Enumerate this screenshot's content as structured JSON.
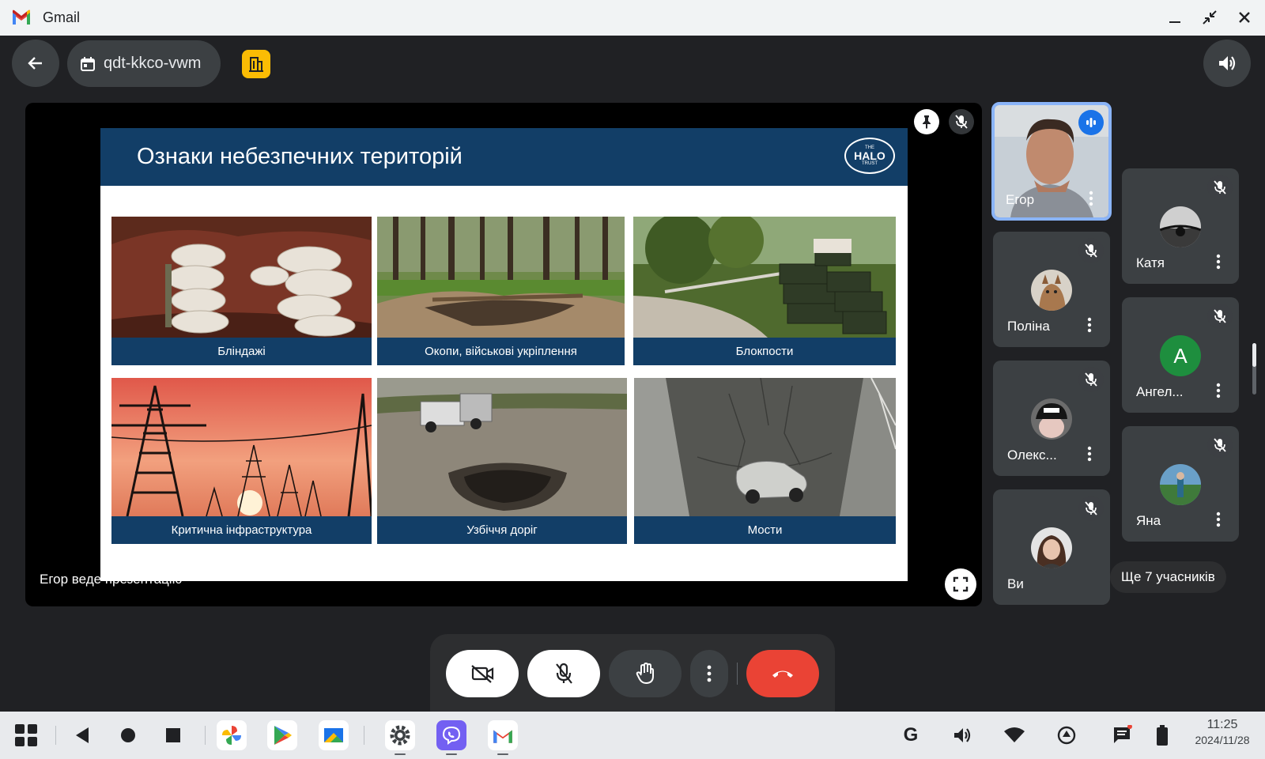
{
  "window": {
    "app_title": "Gmail"
  },
  "meeting": {
    "code": "qdt-kkco-vwm",
    "presenter_note": "Егор веде презентацію",
    "more_participants": "Ще 7 учасників"
  },
  "slide": {
    "title": "Ознаки небезпечних територій",
    "logo": {
      "line1": "THE",
      "line2": "HALO",
      "line3": "TRUST"
    },
    "items": [
      {
        "caption": "Бліндажі"
      },
      {
        "caption": "Окопи, військові укріплення"
      },
      {
        "caption": "Блокпости"
      },
      {
        "caption": "Критична інфраструктура"
      },
      {
        "caption": "Узбіччя доріг"
      },
      {
        "caption": "Мости"
      }
    ]
  },
  "participants": [
    {
      "name": "Егор",
      "speaking": true
    },
    {
      "name": "Поліна",
      "muted": true
    },
    {
      "name": "Олекс...",
      "muted": true
    },
    {
      "name": "Ви",
      "muted": true
    },
    {
      "name": "Катя",
      "muted": true
    },
    {
      "name": "Ангел...",
      "muted": true,
      "initial": "A"
    },
    {
      "name": "Яна",
      "muted": true
    }
  ],
  "controls": {
    "camera": "camera-off",
    "mic": "mic-off",
    "hand": "raise-hand",
    "more": "more-options",
    "end": "end-call"
  },
  "taskbar": {
    "time": "11:25",
    "date": "2024/11/28"
  },
  "colors": {
    "meet_bg": "#202124",
    "slide_navy": "#123e67",
    "end_call_red": "#ea4335",
    "host_badge_yellow": "#fbbc04",
    "active_speaker_blue": "#8ab4f8",
    "avatar_green": "#1e8e3e"
  }
}
